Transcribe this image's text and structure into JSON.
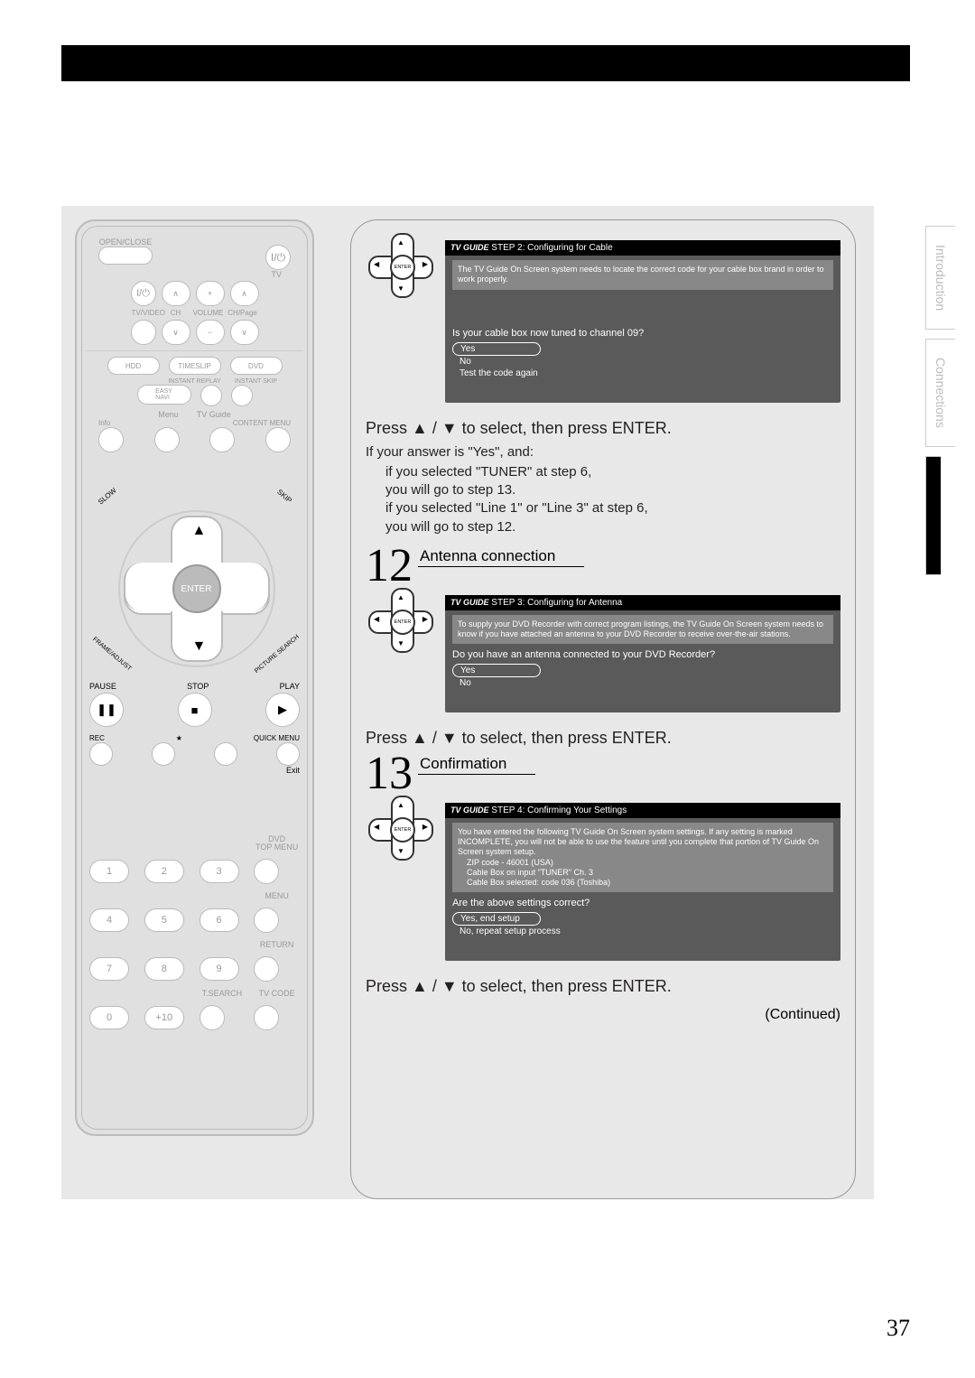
{
  "page_number": "37",
  "continued": "(Continued)",
  "tabs": {
    "intro": "Introduction",
    "conn": "Connections"
  },
  "remote": {
    "open_close": "OPEN/CLOSE",
    "tv": "TV",
    "tv_video": "TV/VIDEO",
    "ch": "CH",
    "volume": "VOLUME",
    "ch_page": "CH/Page",
    "hdd": "HDD",
    "timeslip": "TIMESLIP",
    "dvd": "DVD",
    "easy_navi": "EASY\nNAVI",
    "instant_replay": "INSTANT REPLAY",
    "instant_skip": "INSTANT SKIP",
    "menu": "Menu",
    "tv_guide": "TV Guide",
    "info": "Info",
    "content_menu": "CONTENT MENU",
    "slow": "SLOW",
    "skip": "SKIP",
    "enter": "ENTER",
    "frame_adjust": "FRAME/ADJUST",
    "picture_search": "PICTURE SEARCH",
    "pause": "PAUSE",
    "stop": "STOP",
    "play": "PLAY",
    "rec": "REC",
    "quick_menu": "QUICK MENU",
    "exit": "Exit",
    "dvd_top_menu": "DVD\nTOP MENU",
    "menu2": "MENU",
    "return": "RETURN",
    "tsearch": "T.SEARCH",
    "tv_code": "TV CODE",
    "nums": [
      "1",
      "2",
      "3",
      "4",
      "5",
      "6",
      "7",
      "8",
      "9",
      "0",
      "+10"
    ]
  },
  "step11": {
    "press": "Press ▲ / ▼ to select, then press ENTER.",
    "answer_intro": "If your answer is \"Yes\", and:",
    "l1": "if you selected \"TUNER\" at step 6,",
    "l2": "you will go to step 13.",
    "l3": "if you selected \"Line 1\" or \"Line 3\" at step 6,",
    "l4": "you will go to step 12.",
    "screen": {
      "brand": "TV GUIDE",
      "header": "STEP 2: Configuring for Cable",
      "sub": "The TV Guide On Screen system needs to locate the correct code for your cable box brand in order to work properly.",
      "question": "Is your cable box now tuned to channel 09?",
      "opts": [
        "Yes",
        "No",
        "Test the code again"
      ]
    }
  },
  "step12": {
    "num": "12",
    "title": "Antenna connection",
    "press": "Press ▲ / ▼ to select, then press ENTER.",
    "screen": {
      "brand": "TV GUIDE",
      "header": "STEP 3: Configuring for Antenna",
      "sub": "To supply your DVD Recorder with correct program listings, the TV Guide On Screen system needs to know if you have attached an antenna to your DVD Recorder to receive over-the-air stations.",
      "question": "Do you have an antenna connected to your DVD Recorder?",
      "opts": [
        "Yes",
        "No"
      ]
    }
  },
  "step13": {
    "num": "13",
    "title": "Confirmation",
    "press": "Press ▲ / ▼ to select, then press ENTER.",
    "screen": {
      "brand": "TV GUIDE",
      "header": "STEP 4: Confirming Your Settings",
      "sub": "You have entered the following TV Guide On Screen system settings. If any setting is marked INCOMPLETE, you will not be able to use the feature until you complete that portion of TV Guide On Screen system setup.",
      "line1": "ZIP code - 46001 (USA)",
      "line2": "Cable Box on input \"TUNER\" Ch. 3",
      "line3": "Cable Box selected: code 036 (Toshiba)",
      "question": "Are the above settings correct?",
      "opts": [
        "Yes, end setup",
        "No, repeat setup process"
      ]
    }
  },
  "dpad": {
    "enter": "ENTER"
  }
}
